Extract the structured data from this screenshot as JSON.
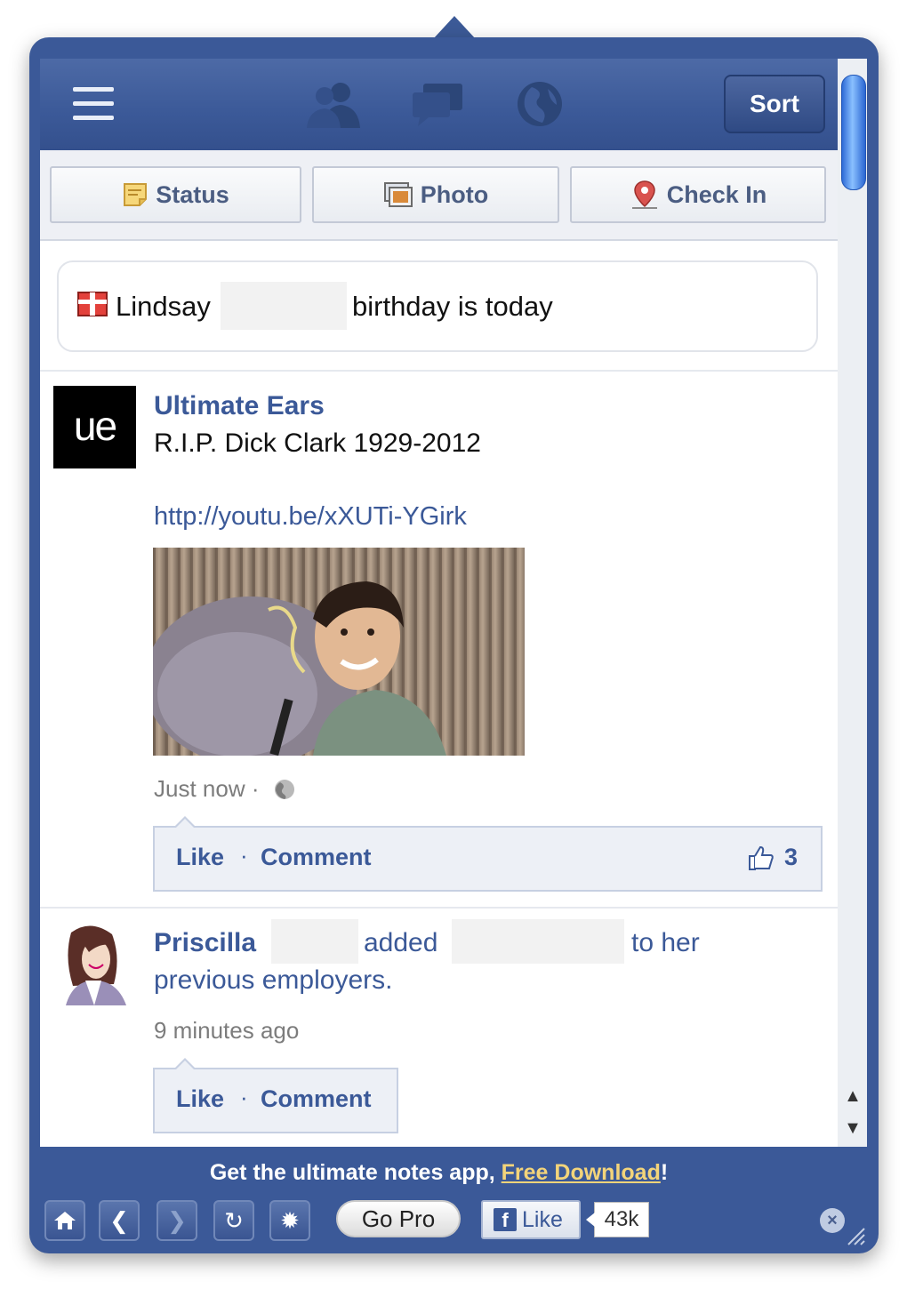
{
  "header": {
    "sort_label": "Sort",
    "icons": [
      "menu-icon",
      "friends-icon",
      "messages-icon",
      "globe-icon"
    ]
  },
  "actions": {
    "status": "Status",
    "photo": "Photo",
    "checkin": "Check In"
  },
  "birthday": {
    "first_name": "Lindsay",
    "suffix": "birthday is today"
  },
  "posts": [
    {
      "author": "Ultimate Ears",
      "logo_text": "ue",
      "text": "R.I.P. Dick Clark 1929-2012",
      "link": "http://youtu.be/xXUTi-YGirk",
      "time": "Just now ·",
      "like": "Like",
      "sep": "·",
      "comment": "Comment",
      "likes": "3"
    },
    {
      "author": "Priscilla",
      "verb": "added",
      "tail": "to her",
      "line2": "previous employers.",
      "time": "9 minutes ago",
      "like": "Like",
      "sep": "·",
      "comment": "Comment"
    }
  ],
  "footer": {
    "promo_prefix": "Get the ultimate notes app, ",
    "promo_link": "Free Download",
    "promo_suffix": "!",
    "gopro": "Go Pro",
    "fb_like": "Like",
    "fb_f": "f",
    "like_count": "43k"
  },
  "colors": {
    "brand": "#3b5998",
    "link": "#3b5998",
    "promo_link": "#f3d47a"
  }
}
